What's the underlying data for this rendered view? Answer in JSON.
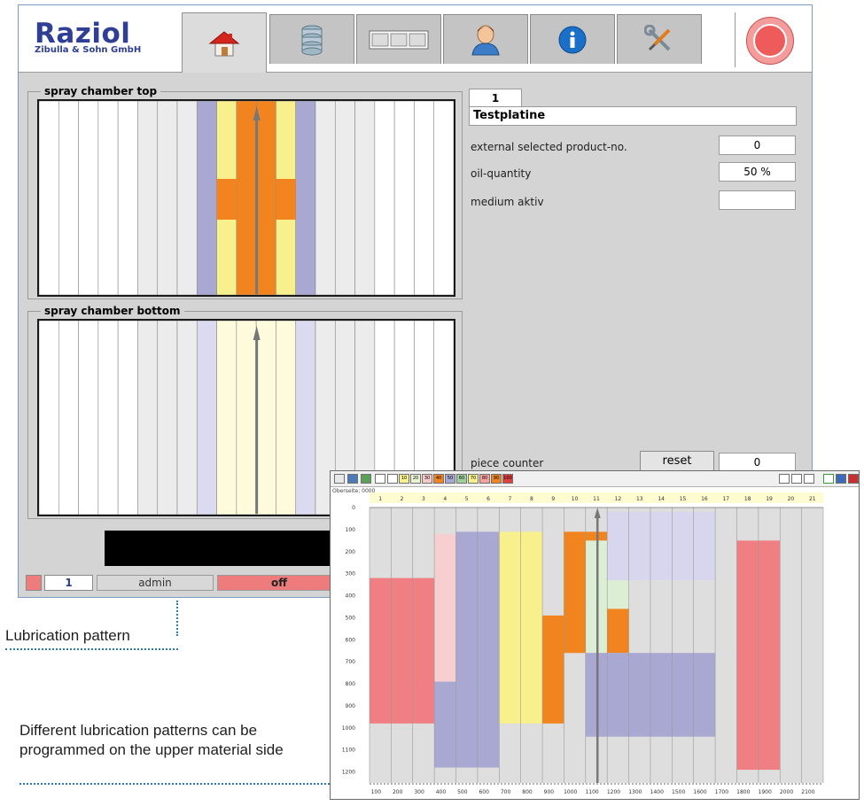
{
  "header": {
    "logo_title": "Raziol",
    "logo_subtitle": "Zibulla & Sohn GmbH",
    "tabs": [
      {
        "name": "home",
        "icon": "house-icon"
      },
      {
        "name": "database",
        "icon": "database-icon"
      },
      {
        "name": "layout",
        "icon": "three-panels-icon"
      },
      {
        "name": "user",
        "icon": "user-icon"
      },
      {
        "name": "info",
        "icon": "info-icon"
      },
      {
        "name": "tools",
        "icon": "wrench-screwdriver-icon"
      }
    ],
    "stop_icon": "stop-button-icon"
  },
  "spray_top": {
    "title": "spray chamber top",
    "columns": [
      "#ffffff",
      "#ffffff",
      "#ffffff",
      "#ffffff",
      "#ffffff",
      "#ececec",
      "#ececec",
      "#ececec",
      "#a9a8d2",
      "#f7f08c",
      "#f2841f",
      "#f2841f",
      "#f7f08c",
      "#a9a8d2",
      "#ececec",
      "#ececec",
      "#ececec",
      "#ffffff",
      "#ffffff",
      "#ffffff",
      "#ffffff"
    ]
  },
  "spray_bottom": {
    "title": "spray chamber bottom",
    "columns": [
      "#ffffff",
      "#ffffff",
      "#ffffff",
      "#ffffff",
      "#ffffff",
      "#ececec",
      "#ececec",
      "#ececec",
      "#dcdaf0",
      "#fdfbdc",
      "#fdfbdc",
      "#fdfbdc",
      "#fdfbdc",
      "#dcdaf0",
      "#ececec",
      "#ececec",
      "#ececec",
      "#ffffff",
      "#ffffff",
      "#ffffff",
      "#ffffff"
    ]
  },
  "product": {
    "tab_number": "1",
    "name": "Testplatine",
    "fields": [
      {
        "label": "external selected product-no.",
        "value": "0"
      },
      {
        "label": "oil-quantity",
        "value": "50 %"
      },
      {
        "label": "medium aktiv",
        "value": ""
      }
    ],
    "piece_counter_label": "piece counter",
    "reset_label": "reset",
    "piece_counter_value": "0"
  },
  "status_bar": {
    "number": "1",
    "user": "admin",
    "state": "off"
  },
  "annotations": {
    "pattern_label": "Lubrication pattern",
    "description": "Different lubrication patterns can be programmed on the upper material side"
  },
  "editor": {
    "subtitle": "Oberseite; 0000",
    "toolbar_numbers": [
      "10",
      "20",
      "30",
      "40",
      "50",
      "60",
      "70",
      "80",
      "90",
      "100"
    ],
    "toolbar_colors": [
      "#ffffff",
      "#f7f08c",
      "#e8f5d0",
      "#f8c8c8",
      "#f2841f",
      "#a9a8d2",
      "#9dd09d",
      "#f7f08c",
      "#f7a0a0",
      "#f2841f",
      "#e04040"
    ],
    "column_numbers": [
      "1",
      "2",
      "3",
      "4",
      "5",
      "6",
      "7",
      "8",
      "9",
      "10",
      "11",
      "12",
      "13",
      "14",
      "15",
      "16",
      "17",
      "18",
      "19",
      "20",
      "21"
    ],
    "y_ticks": [
      "0",
      "100",
      "200",
      "300",
      "400",
      "500",
      "600",
      "700",
      "800",
      "900",
      "1000",
      "1100",
      "1200"
    ],
    "x_ticks": [
      "100",
      "200",
      "300",
      "400",
      "500",
      "600",
      "700",
      "800",
      "900",
      "1000",
      "1100",
      "1200",
      "1300",
      "1400",
      "1500",
      "1600",
      "1700",
      "1800",
      "1900",
      "2000",
      "2100"
    ]
  },
  "chart_data": {
    "type": "heatmap",
    "x_unit": "column index (1-21)",
    "y_range": [
      0,
      1250
    ],
    "blocks": [
      {
        "col_from": 1,
        "col_to": 3,
        "y_from": 320,
        "y_to": 980,
        "color": "#f07f83"
      },
      {
        "col_from": 4,
        "col_to": 4,
        "y_from": 120,
        "y_to": 790,
        "color": "#f8cfd0"
      },
      {
        "col_from": 4,
        "col_to": 4,
        "y_from": 790,
        "y_to": 1180,
        "color": "#a9a8d2"
      },
      {
        "col_from": 5,
        "col_to": 6,
        "y_from": 110,
        "y_to": 1180,
        "color": "#a9a8d2"
      },
      {
        "col_from": 7,
        "col_to": 8,
        "y_from": 110,
        "y_to": 980,
        "color": "#f7f08c"
      },
      {
        "col_from": 9,
        "col_to": 9,
        "y_from": 490,
        "y_to": 980,
        "color": "#f2841f"
      },
      {
        "col_from": 10,
        "col_to": 11,
        "y_from": 110,
        "y_to": 660,
        "color": "#f2841f"
      },
      {
        "col_from": 11,
        "col_to": 11,
        "y_from": 150,
        "y_to": 660,
        "color": "#dcefd5"
      },
      {
        "col_from": 12,
        "col_to": 12,
        "y_from": 20,
        "y_to": 330,
        "color": "#d8d6ee"
      },
      {
        "col_from": 12,
        "col_to": 12,
        "y_from": 330,
        "y_to": 460,
        "color": "#dcefd5"
      },
      {
        "col_from": 12,
        "col_to": 12,
        "y_from": 460,
        "y_to": 660,
        "color": "#f2841f"
      },
      {
        "col_from": 13,
        "col_to": 16,
        "y_from": 20,
        "y_to": 330,
        "color": "#d8d6ee"
      },
      {
        "col_from": 11,
        "col_to": 16,
        "y_from": 660,
        "y_to": 1040,
        "color": "#a9a8d2"
      },
      {
        "col_from": 18,
        "col_to": 19,
        "y_from": 150,
        "y_to": 1190,
        "color": "#f07f83"
      }
    ]
  }
}
